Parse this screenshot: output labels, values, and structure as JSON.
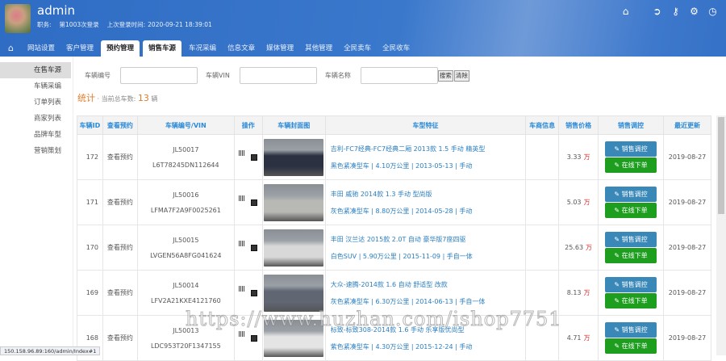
{
  "header": {
    "username": "admin",
    "role_label": "职务:",
    "login_count": "第1003次登录",
    "last_login_label": "上次登录时间:",
    "last_login": "2020-09-21 18:39:01"
  },
  "top_icons": [
    "home-icon",
    "skype-icon",
    "key-icon",
    "gear-icon",
    "clock-icon"
  ],
  "nav": {
    "items": [
      "网站设置",
      "客户管理",
      "预约管理",
      "销售车源",
      "车况采编",
      "信息文章",
      "媒体管理",
      "其他管理",
      "全民卖车",
      "全民收车"
    ],
    "active": [
      "预约管理",
      "销售车源"
    ]
  },
  "sidebar": {
    "items": [
      "在售车源",
      "车辆采编",
      "订单列表",
      "商家列表",
      "品牌车型",
      "营销策划"
    ]
  },
  "search": {
    "field1_label": "车辆编号",
    "field2_label": "车辆VIN",
    "field3_label": "车辆名称",
    "search_btn": "搜索",
    "clear_btn": "清除"
  },
  "stats": {
    "title": "统计",
    "label": "· 当前总车数:",
    "count": "13",
    "unit": "辆"
  },
  "table": {
    "headers": [
      "车辆ID",
      "查看预约",
      "车辆编号/VIN",
      "操作",
      "车辆封面图",
      "车型特征",
      "车商信息",
      "销售价格",
      "销售调控",
      "最近更新"
    ],
    "price_unit": "万",
    "btn_control": "销售调控",
    "btn_order": "在线下单",
    "rows": [
      {
        "id": "172",
        "appt": "查看预约",
        "code": "JL50017",
        "vin": "L6T78245DN112644",
        "title": "吉利-FC7经典-FC7经典二厢 2013款 1.5 手动 精英型",
        "detail": "黑色紧凑型车 | 4.10万公里 | 2013-05-13 | 手动",
        "price": "3.33",
        "updated": "2019-08-27",
        "color": "#2b3140"
      },
      {
        "id": "171",
        "appt": "查看预约",
        "code": "JL50016",
        "vin": "LFMA7F2A9F0025261",
        "title": "丰田 威驰 2014款 1.3 手动 型尚版",
        "detail": "灰色紧凑型车 | 8.80万公里 | 2014-05-28 | 手动",
        "price": "5.03",
        "updated": "2019-08-27",
        "color": "#b8b8b4"
      },
      {
        "id": "170",
        "appt": "查看预约",
        "code": "JL50015",
        "vin": "LVGEN56A8FG041624",
        "title": "丰田 汉兰达 2015款 2.0T 自动 豪华版7座四驱",
        "detail": "白色SUV | 5.90万公里 | 2015-11-09 | 手自一体",
        "price": "25.63",
        "updated": "2019-08-27",
        "color": "#d8d8d8"
      },
      {
        "id": "169",
        "appt": "查看预约",
        "code": "JL50014",
        "vin": "LFV2A21KXE4121760",
        "title": "大众-速腾-2014款 1.6 自动 舒适型 改款",
        "detail": "灰色紧凑型车 | 6.30万公里 | 2014-06-13 | 手自一体",
        "price": "8.13",
        "updated": "2019-08-27",
        "color": "#606672"
      },
      {
        "id": "168",
        "appt": "查看预约",
        "code": "JL50013",
        "vin": "LDC953T20F1347155",
        "title": "标致-标致308-2014款 1.6 手动 乐享版优尚型",
        "detail": "紫色紧凑型车 | 4.30万公里 | 2015-12-24 | 手动",
        "price": "4.71",
        "updated": "2019-08-27",
        "color": "#e4e4e4"
      }
    ]
  },
  "status_url": "150.158.96.89:160/admin/Index#1",
  "watermark": "https://www.huzhan.com/ishop7751"
}
